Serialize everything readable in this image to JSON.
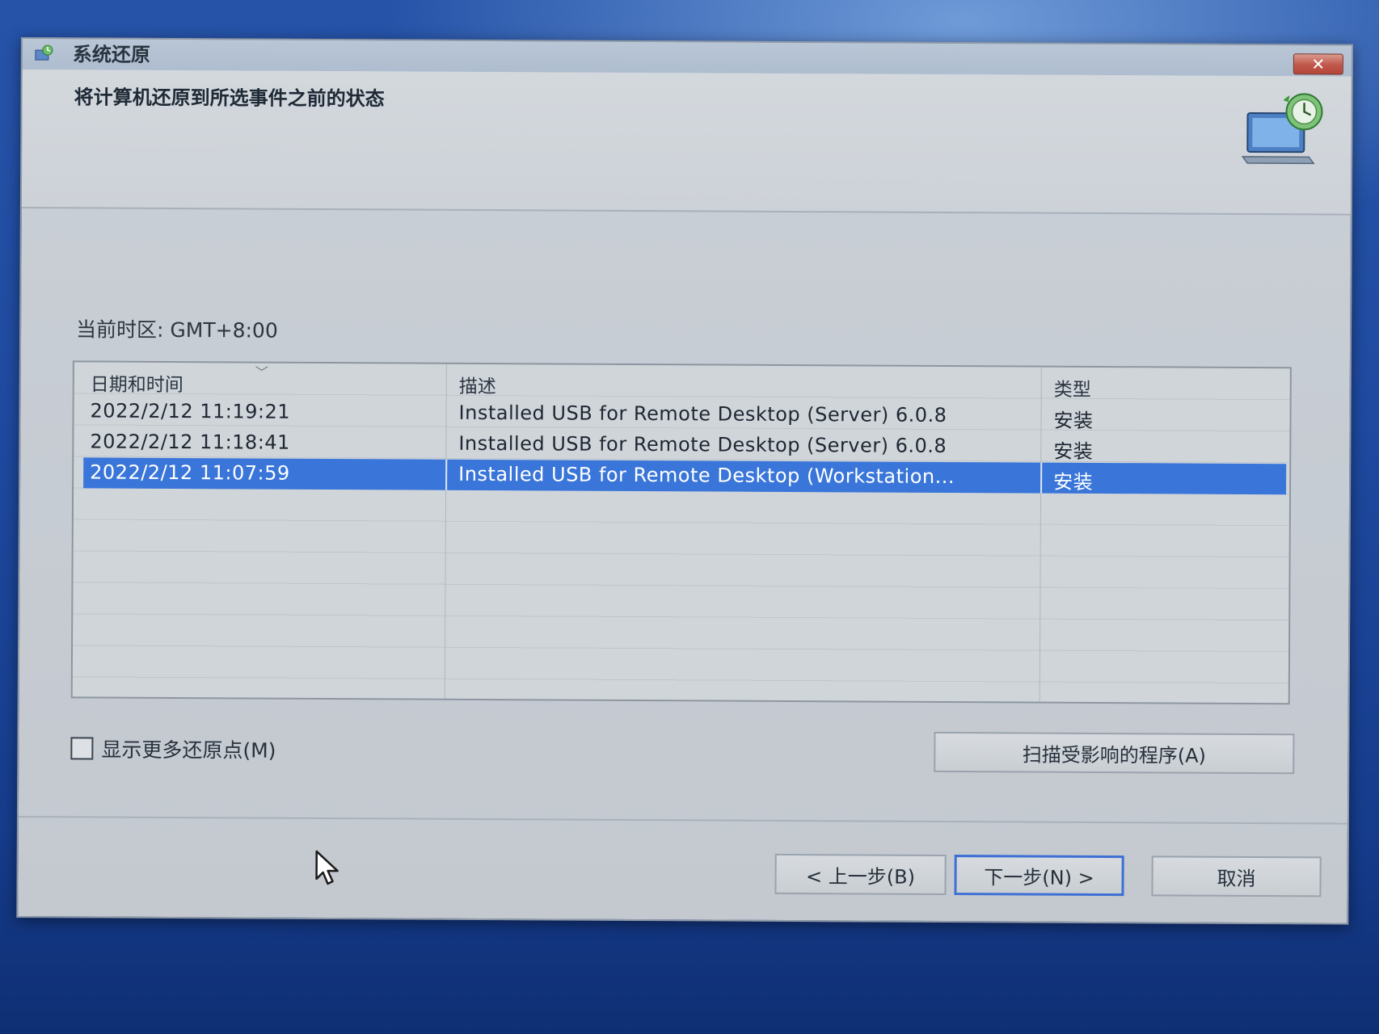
{
  "window": {
    "title": "系统还原",
    "close_label": "✕"
  },
  "header": {
    "title": "将计算机还原到所选事件之前的状态"
  },
  "timezone": {
    "label": "当前时区: GMT+8:00"
  },
  "table": {
    "columns": [
      "日期和时间",
      "描述",
      "类型"
    ],
    "rows": [
      {
        "date": "2022/2/12 11:19:21",
        "description": "Installed USB for Remote Desktop (Server) 6.0.8",
        "type": "安装"
      },
      {
        "date": "2022/2/12 11:18:41",
        "description": "Installed USB for Remote Desktop (Server) 6.0.8",
        "type": "安装"
      },
      {
        "date": "2022/2/12 11:07:59",
        "description": "Installed USB for Remote Desktop (Workstation...",
        "type": "安装",
        "selected": true
      }
    ]
  },
  "options": {
    "show_more_label": "显示更多还原点(M)",
    "show_more_checked": false
  },
  "buttons": {
    "scan": "扫描受影响的程序(A)",
    "back": "< 上一步(B)",
    "next": "下一步(N) >",
    "cancel": "取消"
  },
  "colors": {
    "selection": "#3a76d9",
    "desktop": "#1f4aa0"
  }
}
